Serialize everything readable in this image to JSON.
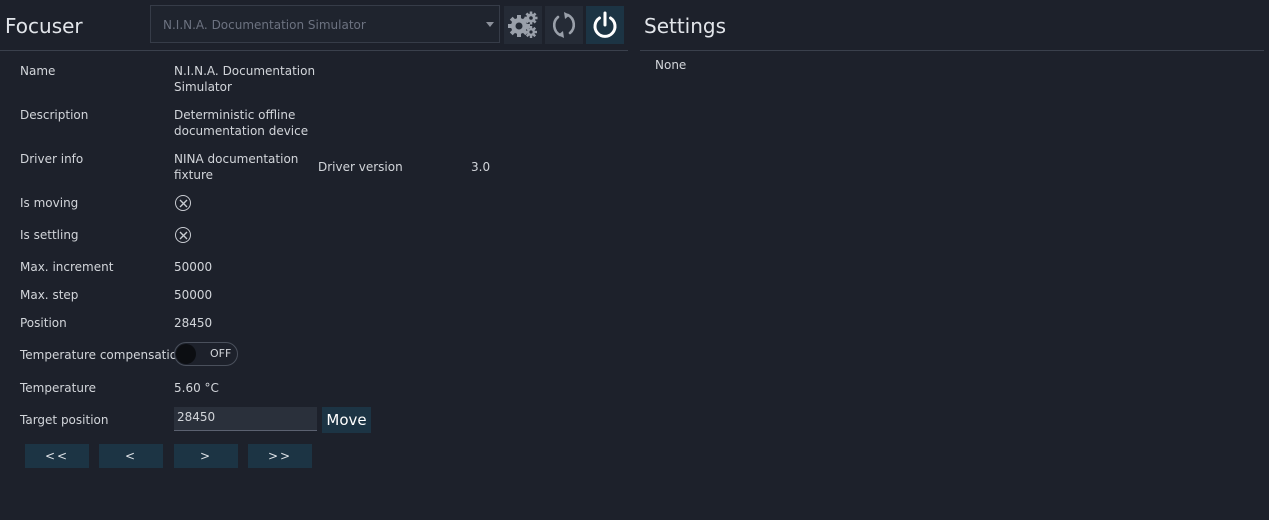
{
  "focuser": {
    "title": "Focuser",
    "device_selected": "N.I.N.A. Documentation Simulator",
    "toolbar": {
      "settings_icon": "gears-icon",
      "refresh_icon": "refresh-icon",
      "connect_icon": "power-icon"
    },
    "labels": {
      "name": "Name",
      "description": "Description",
      "driver_info": "Driver info",
      "driver_version": "Driver version",
      "is_moving": "Is moving",
      "is_settling": "Is settling",
      "max_increment": "Max. increment",
      "max_step": "Max. step",
      "position": "Position",
      "temp_comp": "Temperature compensation",
      "temperature": "Temperature",
      "target_position": "Target position"
    },
    "values": {
      "name_line1": "N.I.N.A. Documentation",
      "name_line2": "Simulator",
      "description_line1": "Deterministic offline",
      "description_line2": "documentation device",
      "driver_info_line1": "NINA documentation",
      "driver_info_line2": "fixture",
      "driver_version": "3.0",
      "is_moving": false,
      "is_settling": false,
      "max_increment": "50000",
      "max_step": "50000",
      "position": "28450",
      "temp_comp_state": "OFF",
      "temperature": "5.60 °C",
      "target_position": "28450"
    },
    "buttons": {
      "move": "Move",
      "step_big_back": "<<",
      "step_back": "<",
      "step_forward": ">",
      "step_big_forward": ">>"
    }
  },
  "settings": {
    "title": "Settings",
    "value": "None"
  },
  "colors": {
    "background": "#1d212b",
    "accent_button": "#1c3444"
  }
}
